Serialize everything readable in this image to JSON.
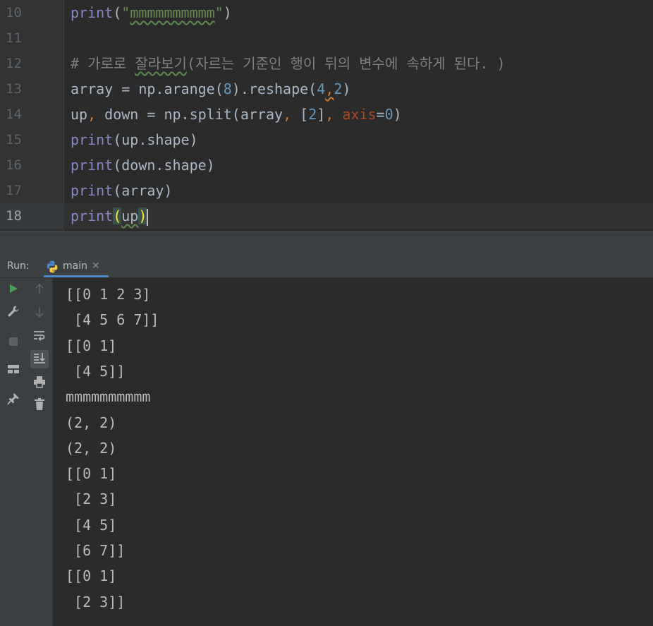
{
  "editor": {
    "current_line": "18",
    "lines": [
      {
        "num": "10",
        "tokens": [
          {
            "t": "print",
            "c": "bi"
          },
          {
            "t": "(",
            "c": ""
          },
          {
            "t": "\"",
            "c": "st"
          },
          {
            "t": "mmmmmmmmmm",
            "c": "st sq"
          },
          {
            "t": "\"",
            "c": "st"
          },
          {
            "t": ")",
            "c": ""
          }
        ]
      },
      {
        "num": "11",
        "tokens": []
      },
      {
        "num": "12",
        "tokens": [
          {
            "t": "# 가로로 ",
            "c": "cm"
          },
          {
            "t": "잘라보기",
            "c": "cm sq"
          },
          {
            "t": "(자르는 기준인 행이 뒤의 변수에 속하게 된다. )",
            "c": "cm"
          }
        ]
      },
      {
        "num": "13",
        "tokens": [
          {
            "t": "array = np.arange(",
            "c": ""
          },
          {
            "t": "8",
            "c": "nu"
          },
          {
            "t": ").reshape(",
            "c": ""
          },
          {
            "t": "4",
            "c": "nu"
          },
          {
            "t": ",",
            "c": "kw sq-kw"
          },
          {
            "t": "2",
            "c": "nu"
          },
          {
            "t": ")",
            "c": ""
          }
        ]
      },
      {
        "num": "14",
        "tokens": [
          {
            "t": "up",
            "c": ""
          },
          {
            "t": ",",
            "c": "kw"
          },
          {
            "t": " down = np.split(array",
            "c": ""
          },
          {
            "t": ",",
            "c": "kw"
          },
          {
            "t": " [",
            "c": ""
          },
          {
            "t": "2",
            "c": "nu"
          },
          {
            "t": "]",
            "c": ""
          },
          {
            "t": ",",
            "c": "kw"
          },
          {
            "t": " ",
            "c": ""
          },
          {
            "t": "axis",
            "c": "kwarg"
          },
          {
            "t": "=",
            "c": ""
          },
          {
            "t": "0",
            "c": "nu"
          },
          {
            "t": ")",
            "c": ""
          }
        ]
      },
      {
        "num": "15",
        "tokens": [
          {
            "t": "print",
            "c": "bi"
          },
          {
            "t": "(up.shape)",
            "c": ""
          }
        ]
      },
      {
        "num": "16",
        "tokens": [
          {
            "t": "print",
            "c": "bi"
          },
          {
            "t": "(down.shape)",
            "c": ""
          }
        ]
      },
      {
        "num": "17",
        "tokens": [
          {
            "t": "print",
            "c": "bi"
          },
          {
            "t": "(array)",
            "c": ""
          }
        ]
      },
      {
        "num": "18",
        "tokens": [
          {
            "t": "print",
            "c": "bi"
          },
          {
            "t": "(",
            "c": "brace-match"
          },
          {
            "t": "up",
            "c": "sq"
          },
          {
            "t": ")",
            "c": "brace-match"
          }
        ]
      }
    ]
  },
  "run": {
    "label": "Run:",
    "tab_label": "main",
    "close_glyph": "✕"
  },
  "console": {
    "lines": [
      "[[0 1 2 3]",
      " [4 5 6 7]]",
      "[[0 1]",
      " [4 5]]",
      "mmmmmmmmmm",
      "(2, 2)",
      "(2, 2)",
      "[[0 1]",
      " [2 3]",
      " [4 5]",
      " [6 7]]",
      "[[0 1]",
      " [2 3]]"
    ]
  },
  "colors": {
    "accent": "#4a88c7",
    "run_green": "#499c54",
    "icon_gray": "#afb1b3"
  },
  "toolbar_left": [
    {
      "name": "rerun-icon",
      "icon": "play"
    },
    {
      "name": "wrench-icon",
      "icon": "wrench"
    },
    {
      "name": "stop-icon",
      "icon": "stop"
    },
    {
      "name": "layout-icon",
      "icon": "layout"
    },
    {
      "name": "pin-icon",
      "icon": "pin"
    }
  ],
  "toolbar_right": [
    {
      "name": "scroll-up-icon",
      "icon": "arrow-up"
    },
    {
      "name": "scroll-down-icon",
      "icon": "arrow-down"
    },
    {
      "name": "soft-wrap-icon",
      "icon": "wrap"
    },
    {
      "name": "scroll-to-end-icon",
      "icon": "scroll-end"
    },
    {
      "name": "print-icon",
      "icon": "printer"
    },
    {
      "name": "trash-icon",
      "icon": "trash"
    }
  ]
}
